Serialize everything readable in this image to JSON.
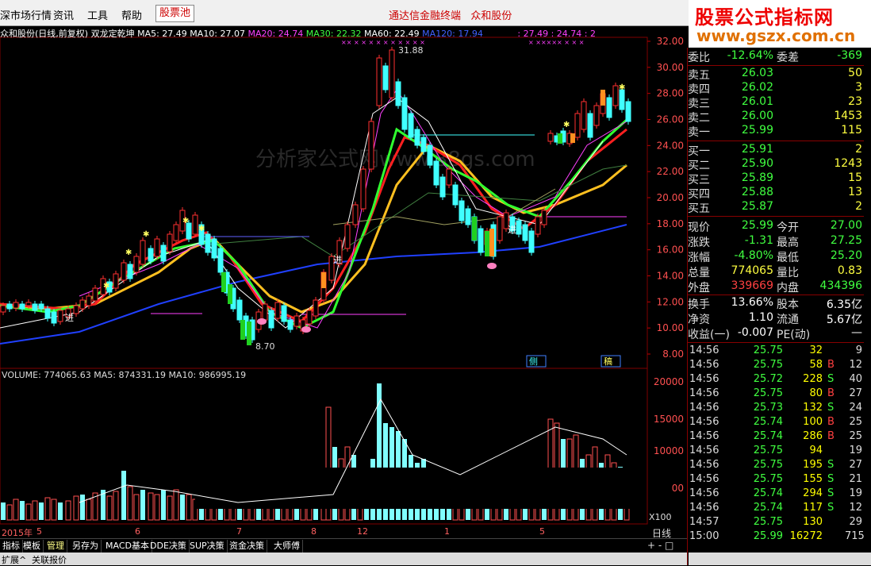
{
  "menu": {
    "items": [
      "深市场行情",
      "资讯",
      "工具",
      "帮助"
    ],
    "stockpool": "股票池",
    "center_title": "通达信金融终端",
    "stock_name": "众和股份"
  },
  "brand": {
    "title": "股票公式指标网",
    "url": "www.gszx.com.cn"
  },
  "chart_title": {
    "name": "众和股份(日线,前复权) 双龙定乾坤",
    "ma5": "MA5: 27.49",
    "ma10": "MA10: 27.07",
    "ma20": "MA20: 24.74",
    "ma30": "MA30: 22.32",
    "ma60": "MA60: 22.49",
    "ma120": "MA120: 17.94",
    "extra1": ": 27.49",
    "extra2": ": 24.74",
    "extra3": ": 2"
  },
  "watermark": "分析家公式网www.88gs.com",
  "annotations": {
    "high_label": "31.88",
    "low_label": "8.70",
    "buy_label": "进",
    "side_label1": "侧",
    "side_label2": "稿"
  },
  "price_axis": [
    "32.00",
    "30.00",
    "28.00",
    "26.00",
    "24.00",
    "22.00",
    "20.00",
    "18.00",
    "16.00",
    "14.00",
    "12.00",
    "10.00",
    "8.00"
  ],
  "volume": {
    "info": "VOLUME: 774065.63  MA5: 874331.19  MA10: 986995.19",
    "axis": [
      "20000",
      "15000",
      "10000",
      "00"
    ],
    "unit": "X100"
  },
  "dates": [
    "2015年",
    "5",
    "6",
    "7",
    "8",
    "12",
    "1",
    "5"
  ],
  "period": "日线",
  "tabs": [
    "指标",
    "模板",
    "管理",
    "另存为",
    "MACD基本",
    "DDE决策",
    "SUP决策",
    "资金决策",
    "大师傅"
  ],
  "bottom_tabs": [
    "扩展^",
    "关联报价"
  ],
  "zoom": "+ - □",
  "quote": {
    "weibi_label": "委比",
    "weibi": "-12.64%",
    "weicha_label": "委差",
    "weicha": "-369",
    "sell": [
      {
        "label": "卖五",
        "price": "26.03",
        "vol": "50"
      },
      {
        "label": "卖四",
        "price": "26.02",
        "vol": "3"
      },
      {
        "label": "卖三",
        "price": "26.01",
        "vol": "23"
      },
      {
        "label": "卖二",
        "price": "26.00",
        "vol": "1453"
      },
      {
        "label": "卖一",
        "price": "25.99",
        "vol": "115"
      }
    ],
    "buy": [
      {
        "label": "买一",
        "price": "25.91",
        "vol": "2"
      },
      {
        "label": "买二",
        "price": "25.90",
        "vol": "1243"
      },
      {
        "label": "买三",
        "price": "25.89",
        "vol": "15"
      },
      {
        "label": "买四",
        "price": "25.88",
        "vol": "13"
      },
      {
        "label": "买五",
        "price": "25.87",
        "vol": "2"
      }
    ],
    "stats1": [
      {
        "l1": "现价",
        "v1": "25.99",
        "c1": "green",
        "l2": "今开",
        "v2": "27.00",
        "c2": "green"
      },
      {
        "l1": "涨跌",
        "v1": "-1.31",
        "c1": "green",
        "l2": "最高",
        "v2": "27.25",
        "c2": "green"
      },
      {
        "l1": "涨幅",
        "v1": "-4.80%",
        "c1": "green",
        "l2": "最低",
        "v2": "25.20",
        "c2": "green"
      },
      {
        "l1": "总量",
        "v1": "774065",
        "c1": "yellow",
        "l2": "量比",
        "v2": "0.83",
        "c2": "yellow"
      },
      {
        "l1": "外盘",
        "v1": "339669",
        "c1": "red",
        "l2": "内盘",
        "v2": "434396",
        "c2": "green"
      }
    ],
    "stats2": [
      {
        "l1": "换手",
        "v1": "13.66%",
        "l2": "股本",
        "v2": "6.35亿"
      },
      {
        "l1": "净资",
        "v1": "1.10",
        "l2": "流通",
        "v2": "5.67亿"
      },
      {
        "l1": "收益(一)",
        "v1": "-0.007",
        "l2": "PE(动)",
        "v2": "—"
      }
    ],
    "ticks": [
      {
        "t": "14:56",
        "p": "25.75",
        "v": "32",
        "bs": "",
        "n": "9"
      },
      {
        "t": "14:56",
        "p": "25.75",
        "v": "58",
        "bs": "B",
        "n": "12"
      },
      {
        "t": "14:56",
        "p": "25.72",
        "v": "228",
        "bs": "S",
        "n": "40"
      },
      {
        "t": "14:56",
        "p": "25.75",
        "v": "80",
        "bs": "B",
        "n": "27"
      },
      {
        "t": "14:56",
        "p": "25.73",
        "v": "132",
        "bs": "S",
        "n": "24"
      },
      {
        "t": "14:56",
        "p": "25.74",
        "v": "100",
        "bs": "B",
        "n": "25"
      },
      {
        "t": "14:56",
        "p": "25.74",
        "v": "286",
        "bs": "B",
        "n": "25"
      },
      {
        "t": "14:56",
        "p": "25.75",
        "v": "94",
        "bs": "",
        "n": "19"
      },
      {
        "t": "14:56",
        "p": "25.75",
        "v": "195",
        "bs": "S",
        "n": "27"
      },
      {
        "t": "14:56",
        "p": "25.75",
        "v": "155",
        "bs": "S",
        "n": "21"
      },
      {
        "t": "14:56",
        "p": "25.74",
        "v": "294",
        "bs": "S",
        "n": "19"
      },
      {
        "t": "14:56",
        "p": "25.74",
        "v": "117",
        "bs": "S",
        "n": "12"
      },
      {
        "t": "14:57",
        "p": "25.75",
        "v": "130",
        "bs": "",
        "n": "29"
      },
      {
        "t": "15:00",
        "p": "25.99",
        "v": "16272",
        "bs": "",
        "n": "715"
      }
    ]
  },
  "colors": {
    "up": "#ff3030",
    "down": "#40ffff",
    "ma_green": "#30ff30",
    "ma_red": "#ff2020",
    "ma_yellow": "#ffc020",
    "ma_blue": "#2040ff"
  }
}
